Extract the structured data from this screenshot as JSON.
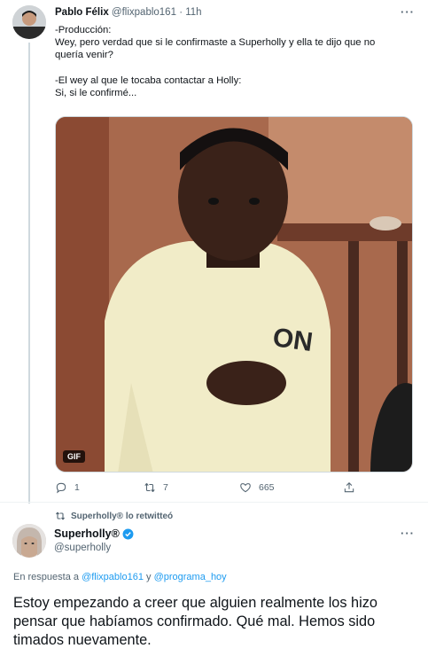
{
  "tweet1": {
    "author_name": "Pablo Félix",
    "author_handle": "@flixpablo161",
    "separator": "·",
    "time": "11h",
    "more_icon": "more-dots",
    "lines": [
      "-Producción:",
      "Wey, pero verdad que si le confirmaste a Superholly y ella te dijo que no",
      "quería venir?",
      "",
      "-El wey al que le tocaba contactar a Holly:",
      "Si, si le confirmé..."
    ],
    "media_badge": "GIF",
    "actions": {
      "reply_count": "1",
      "retweet_count": "7",
      "like_count": "665"
    }
  },
  "retweet_banner": "Superholly® lo retwitteó",
  "tweet2": {
    "author_name": "Superholly®",
    "author_handle": "@superholly",
    "reply_prefix": "En respuesta a",
    "reply_user1": "@flixpablo161",
    "reply_and": "y",
    "reply_user2": "@programa_hoy",
    "text": "Estoy empezando a creer que alguien realmente los hizo pensar que habíamos confirmado. Qué mal. Hemos sido timados nuevamente."
  },
  "colors": {
    "accent": "#1d9bf0",
    "muted": "#536471",
    "text": "#0f1419"
  }
}
